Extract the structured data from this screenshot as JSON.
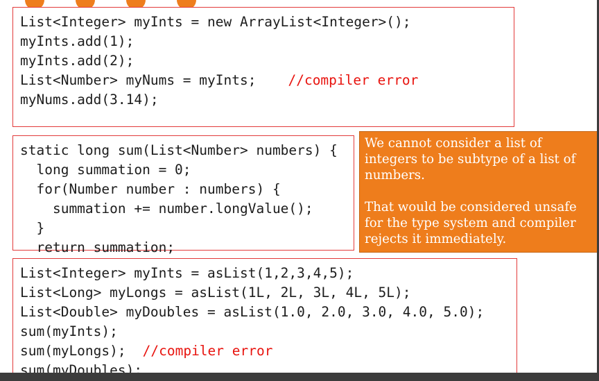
{
  "colors": {
    "accent": "#ee7d1c",
    "code_border": "#e23a3a",
    "comment": "#e8140f",
    "frame": "#3c3c3c"
  },
  "decor": {
    "dot_count": 4
  },
  "code_block_1": {
    "lines": [
      "List<Integer> myInts = new ArrayList<Integer>();",
      "myInts.add(1);",
      "myInts.add(2);",
      "List<Number> myNums = myInts;",
      "myNums.add(3.14);"
    ],
    "comment": "//compiler error"
  },
  "code_block_2": {
    "lines": [
      "static long sum(List<Number> numbers) {",
      "  long summation = 0;",
      "  for(Number number : numbers) {",
      "    summation += number.longValue();",
      "  }",
      "  return summation;",
      "}"
    ]
  },
  "note": {
    "paragraph_1": "We cannot consider a list of integers to be subtype of a list of numbers.",
    "paragraph_2": "That would be considered unsafe for the type system and compiler rejects it immediately."
  },
  "code_block_3": {
    "lines": [
      "List<Integer> myInts = asList(1,2,3,4,5);",
      "List<Long> myLongs = asList(1L, 2L, 3L, 4L, 5L);",
      "List<Double> myDoubles = asList(1.0, 2.0, 3.0, 4.0, 5.0);",
      "sum(myInts);",
      "sum(myLongs);",
      "sum(myDoubles);"
    ],
    "comment": "//compiler error"
  }
}
